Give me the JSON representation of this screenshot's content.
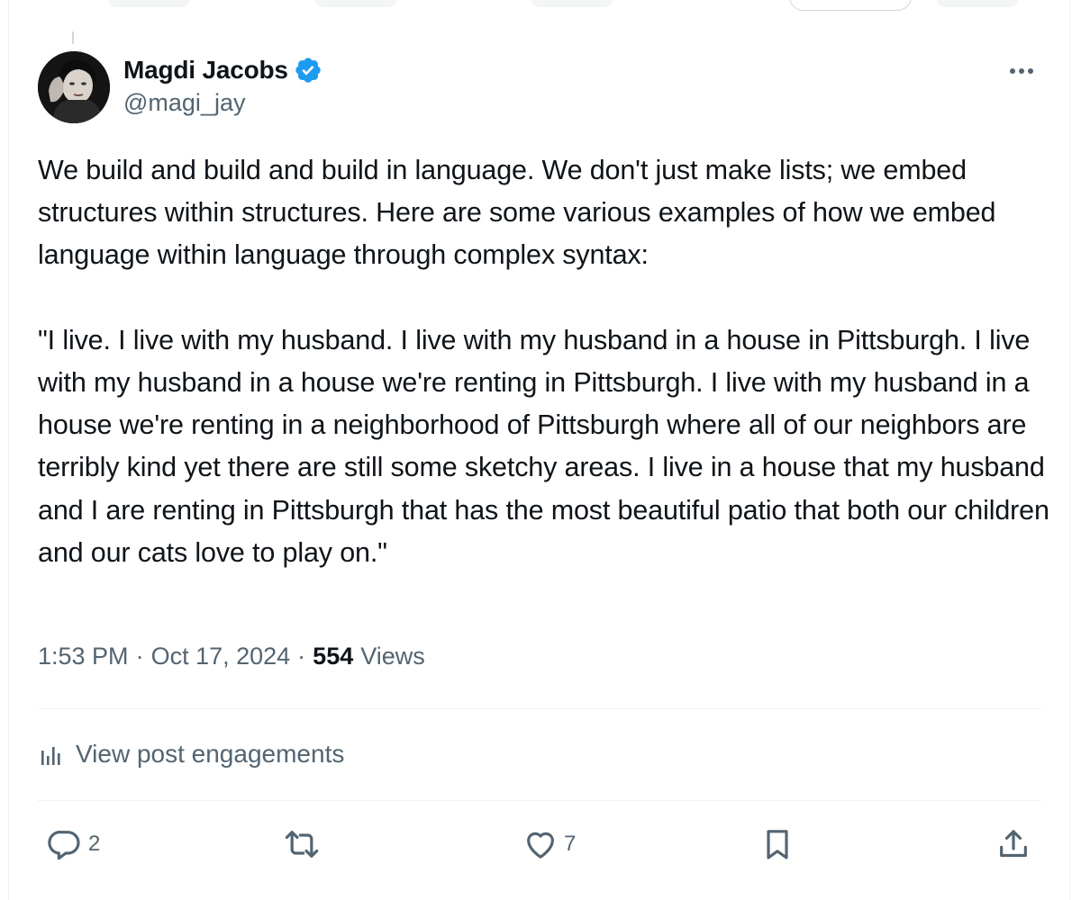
{
  "author": {
    "display_name": "Magdi Jacobs",
    "handle": "@magi_jay",
    "verified": true
  },
  "tweet": {
    "text": "We build and build and build in language. We don't just make lists; we embed structures within structures. Here are some various examples of how we embed language within language through complex syntax:\n\n\"I live. I live with my husband. I live with my husband in a house in Pittsburgh. I live with my husband in a house we're renting in Pittsburgh. I live with my husband in a house we're renting in a neighborhood of Pittsburgh where all of our neighbors are terribly kind yet there are still some sketchy areas. I live in a house that my husband and I are renting in Pittsburgh that has the most beautiful patio that both our children and our cats love to play on.\"",
    "time": "1:53 PM",
    "separator": "·",
    "date": "Oct 17, 2024",
    "views_count": "554",
    "views_label": "Views"
  },
  "engagements": {
    "label": "View post engagements",
    "icon": "bar-chart-icon"
  },
  "actions": {
    "reply": {
      "icon": "reply-icon",
      "count": "2"
    },
    "retweet": {
      "icon": "retweet-icon",
      "count": ""
    },
    "like": {
      "icon": "heart-icon",
      "count": "7"
    },
    "bookmark": {
      "icon": "bookmark-icon",
      "count": ""
    },
    "share": {
      "icon": "share-icon",
      "count": ""
    }
  },
  "colors": {
    "text_primary": "#0f1419",
    "text_secondary": "#536471",
    "verified_blue": "#1d9bf0",
    "divider": "#eff3f4"
  }
}
